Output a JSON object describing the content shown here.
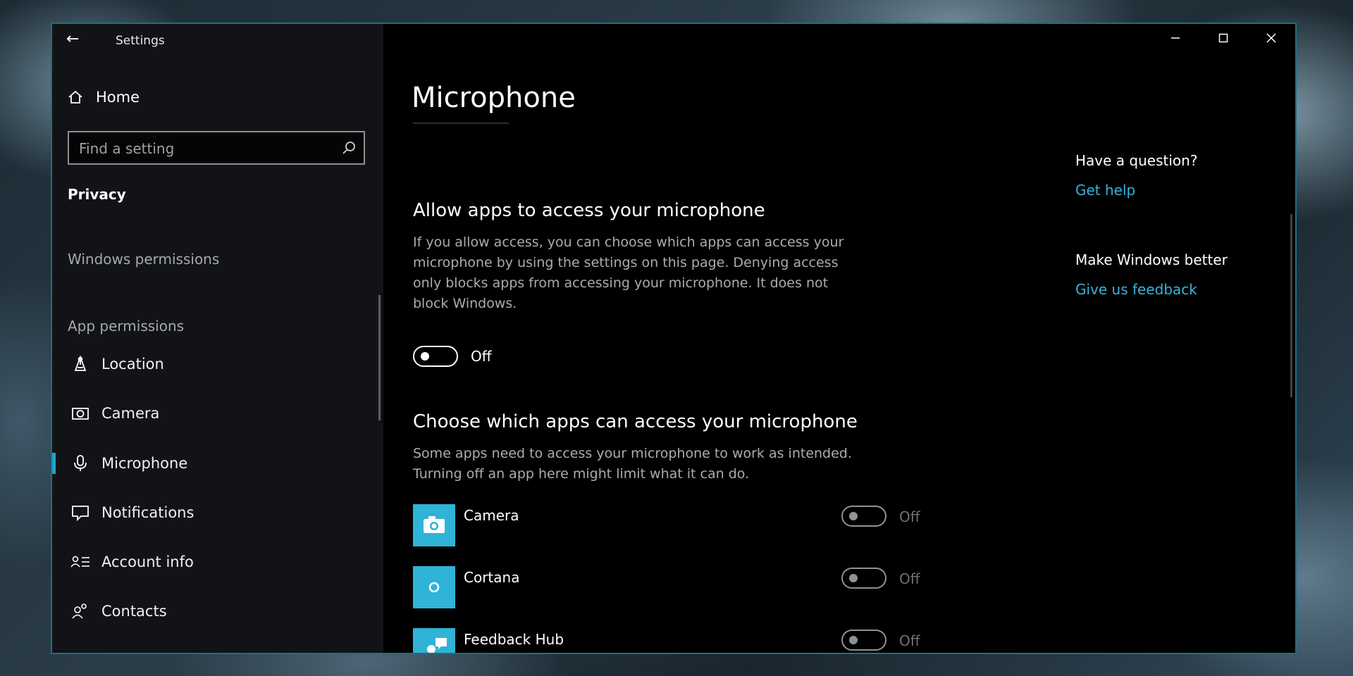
{
  "window": {
    "title": "Settings"
  },
  "sidebar": {
    "home_label": "Home",
    "search": {
      "placeholder": "Find a setting"
    },
    "section_title": "Privacy",
    "windows_permissions_label": "Windows permissions",
    "app_permissions_label": "App permissions",
    "items": [
      {
        "label": "Location",
        "icon": "location-icon"
      },
      {
        "label": "Camera",
        "icon": "camera-icon"
      },
      {
        "label": "Microphone",
        "icon": "microphone-icon",
        "active": true
      },
      {
        "label": "Notifications",
        "icon": "notifications-icon"
      },
      {
        "label": "Account info",
        "icon": "account-info-icon"
      },
      {
        "label": "Contacts",
        "icon": "contacts-icon"
      }
    ]
  },
  "main": {
    "title": "Microphone",
    "allow_section": {
      "heading": "Allow apps to access your microphone",
      "description": "If you allow access, you can choose which apps can access your microphone by using the settings on this page. Denying access only blocks apps from accessing your microphone. It does not block Windows.",
      "toggle_state": "Off"
    },
    "choose_section": {
      "heading": "Choose which apps can access your microphone",
      "description": "Some apps need to access your microphone to work as intended. Turning off an app here might limit what it can do.",
      "apps": [
        {
          "name": "Camera",
          "state": "Off",
          "icon": "camera-app-icon"
        },
        {
          "name": "Cortana",
          "state": "Off",
          "icon": "cortana-app-icon"
        },
        {
          "name": "Feedback Hub",
          "state": "Off",
          "icon": "feedback-hub-app-icon"
        }
      ]
    }
  },
  "side_panel": {
    "question_heading": "Have a question?",
    "get_help_link": "Get help",
    "better_heading": "Make Windows better",
    "feedback_link": "Give us feedback"
  },
  "colors": {
    "accent": "#1ba6c8",
    "link": "#3bb2d9",
    "app_tile": "#2fb3d7",
    "window_bg": "#000000",
    "sidebar_bg": "#121316"
  }
}
